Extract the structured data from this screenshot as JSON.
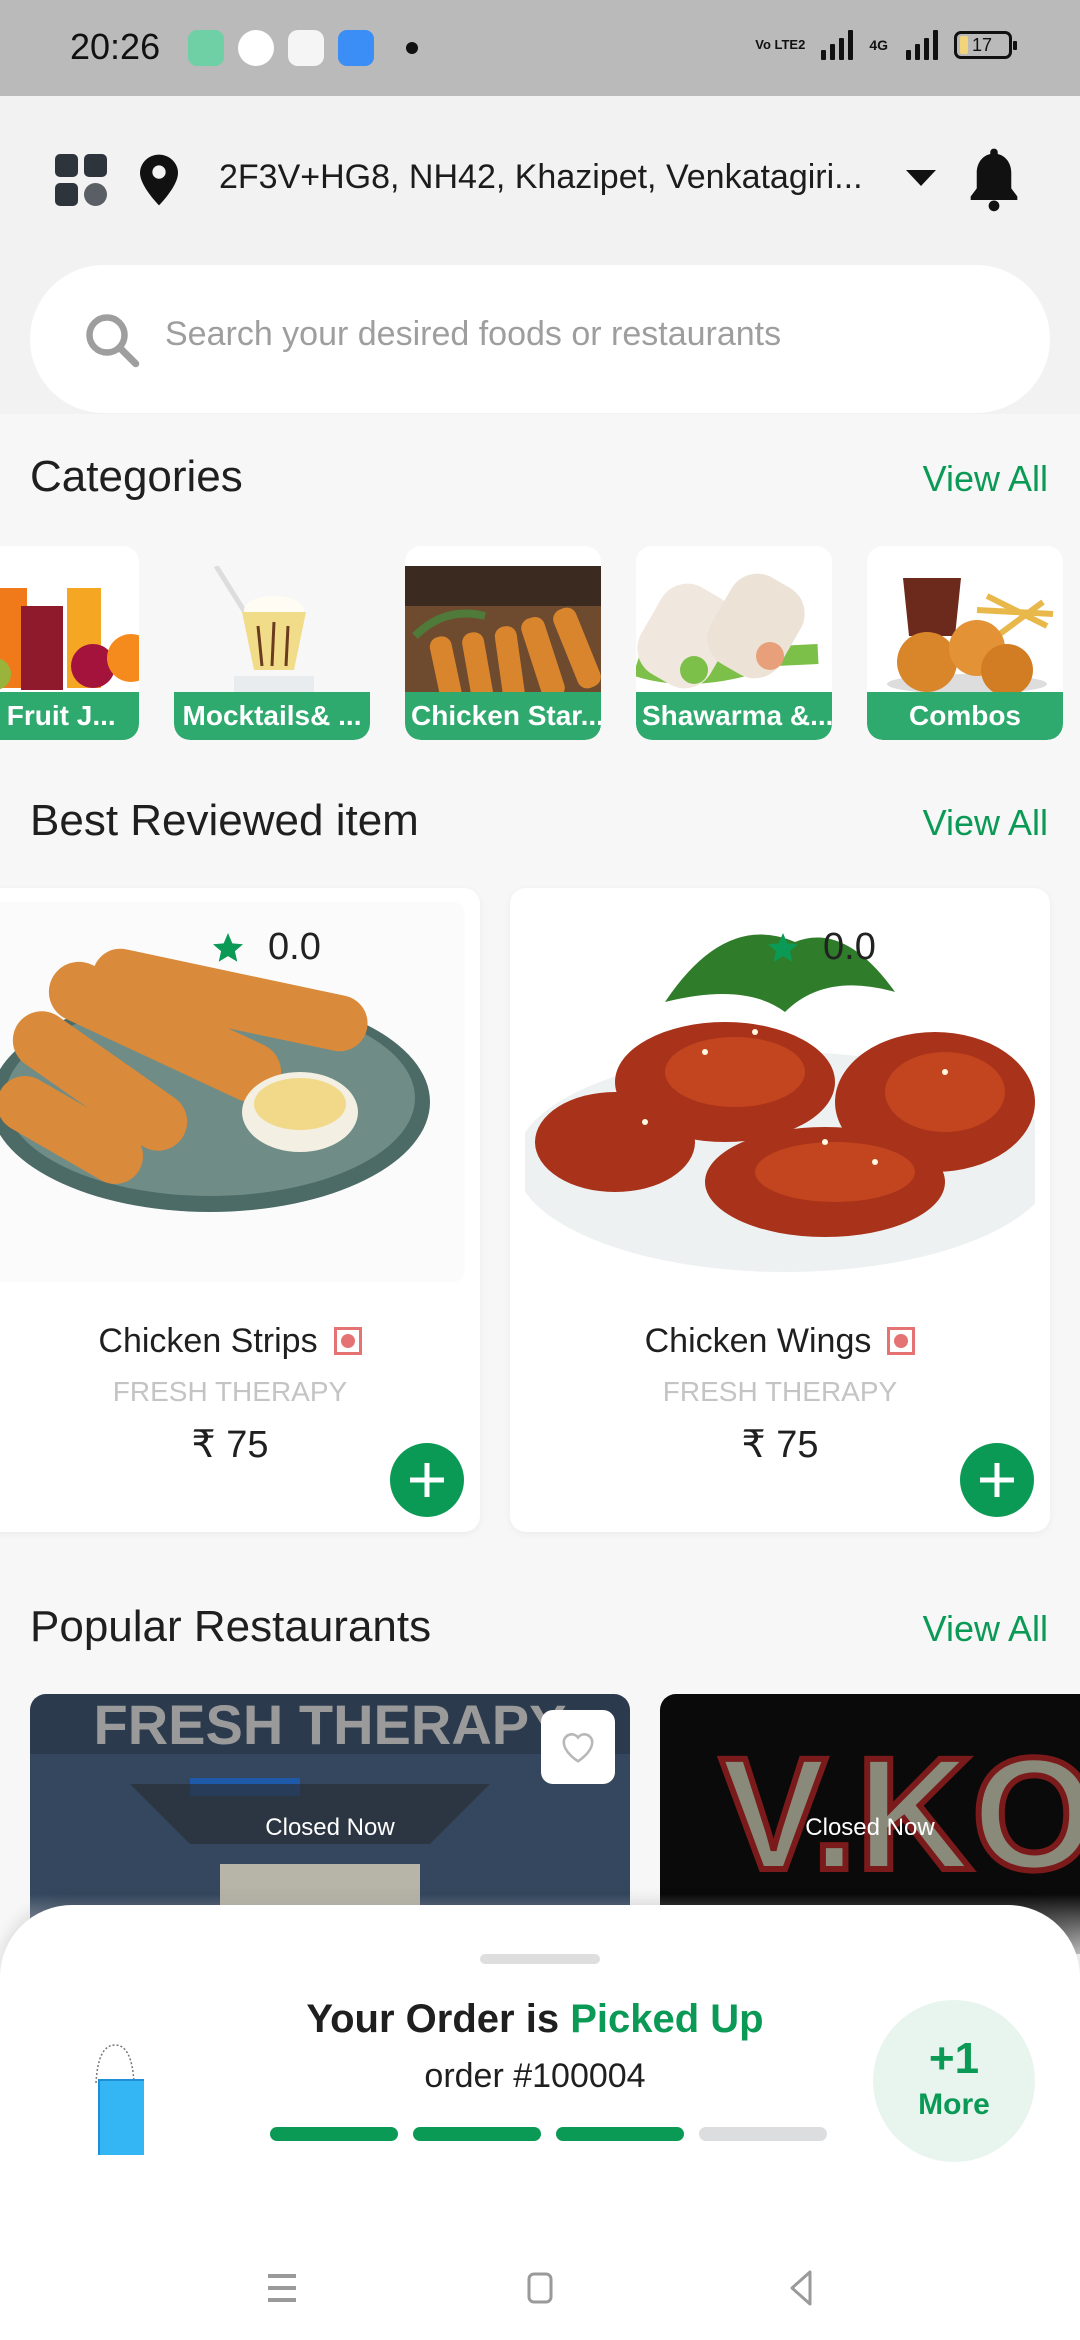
{
  "status_bar": {
    "time": "20:26",
    "network_label": "Vo LTE2",
    "network_type": "4G",
    "battery_level": "17"
  },
  "header": {
    "menu_icon": "grid-menu-icon",
    "location_icon": "location-pin-icon",
    "address": "2F3V+HG8, NH42, Khazipet, Venkatagiri...",
    "dropdown_icon": "caret-down-icon",
    "notification_icon": "bell-icon"
  },
  "search": {
    "icon": "search-icon",
    "placeholder": "Search your desired foods or restaurants"
  },
  "categories": {
    "title": "Categories",
    "view_all": "View All",
    "items": [
      {
        "label": "sh Fruit J..."
      },
      {
        "label": "Mocktails& ..."
      },
      {
        "label": "Chicken Star..."
      },
      {
        "label": "Shawarma &..."
      },
      {
        "label": "Combos"
      }
    ]
  },
  "best_reviewed": {
    "title": "Best Reviewed item",
    "view_all": "View All",
    "items": [
      {
        "rating": "0.0",
        "name": "Chicken Strips",
        "restaurant": "FRESH THERAPY",
        "price": "₹ 75",
        "veg_type": "non-veg"
      },
      {
        "rating": "0.0",
        "name": "Chicken Wings",
        "restaurant": "FRESH THERAPY",
        "price": "₹ 75",
        "veg_type": "non-veg"
      }
    ]
  },
  "popular_restaurants": {
    "title": "Popular Restaurants",
    "view_all": "View All",
    "items": [
      {
        "name_on_image": "FRESH THERAPY",
        "status": "Closed Now",
        "favorite": false
      },
      {
        "name_on_image": "V.KOT",
        "status": "Closed Now"
      }
    ]
  },
  "order_sheet": {
    "title_prefix": "Your Order is",
    "title_status": "Picked Up",
    "order_number": "order #100004",
    "progress_steps_total": 4,
    "progress_steps_done": 3,
    "more_count": "+1",
    "more_label": "More"
  },
  "colors": {
    "accent": "#0b9a55",
    "category_label": "#2eaa6e",
    "nonveg": "#e57373",
    "status_bar": "#bababa"
  },
  "nav_bar": {
    "buttons": [
      "recents-icon",
      "home-icon",
      "back-icon"
    ]
  }
}
